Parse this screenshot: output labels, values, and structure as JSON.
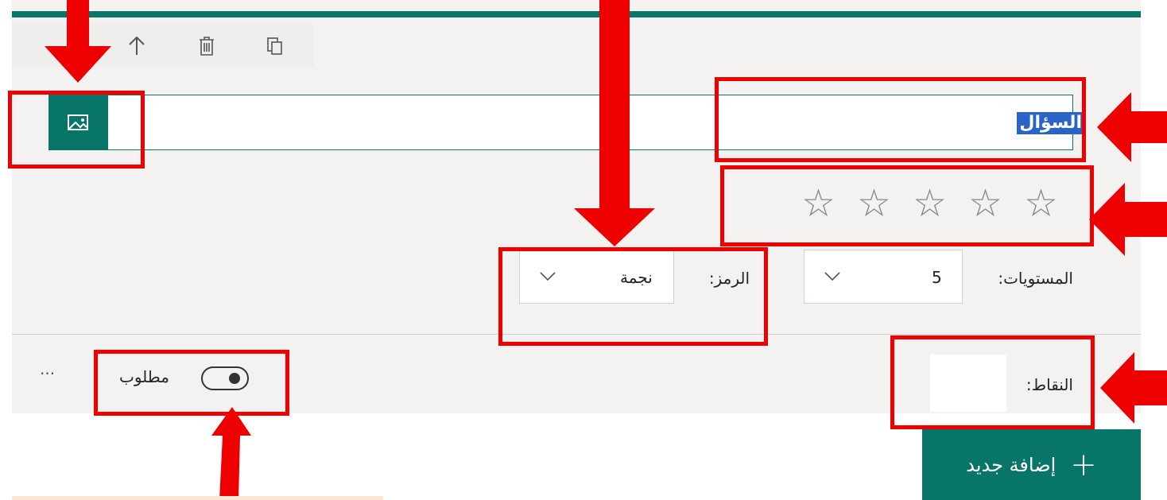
{
  "toolbar": {
    "icons": [
      "arrow-up-icon",
      "trash-icon",
      "copy-icon"
    ]
  },
  "question": {
    "text": "السؤال",
    "image_button_icon": "image-icon"
  },
  "rating": {
    "stars": 5,
    "star_glyph": "☆"
  },
  "levels": {
    "label": "المستويات:",
    "value": "5"
  },
  "symbol": {
    "label": "الرمز:",
    "value": "نجمة"
  },
  "points": {
    "label": "النقاط:",
    "value": ""
  },
  "required": {
    "label": "مطلوب",
    "enabled": false
  },
  "more": {
    "label": "···"
  },
  "add_new": {
    "label": "إضافة جديد",
    "icon": "+"
  },
  "colors": {
    "accent": "#077568",
    "highlight": "#ee0000",
    "selection": "#2b64c9"
  }
}
